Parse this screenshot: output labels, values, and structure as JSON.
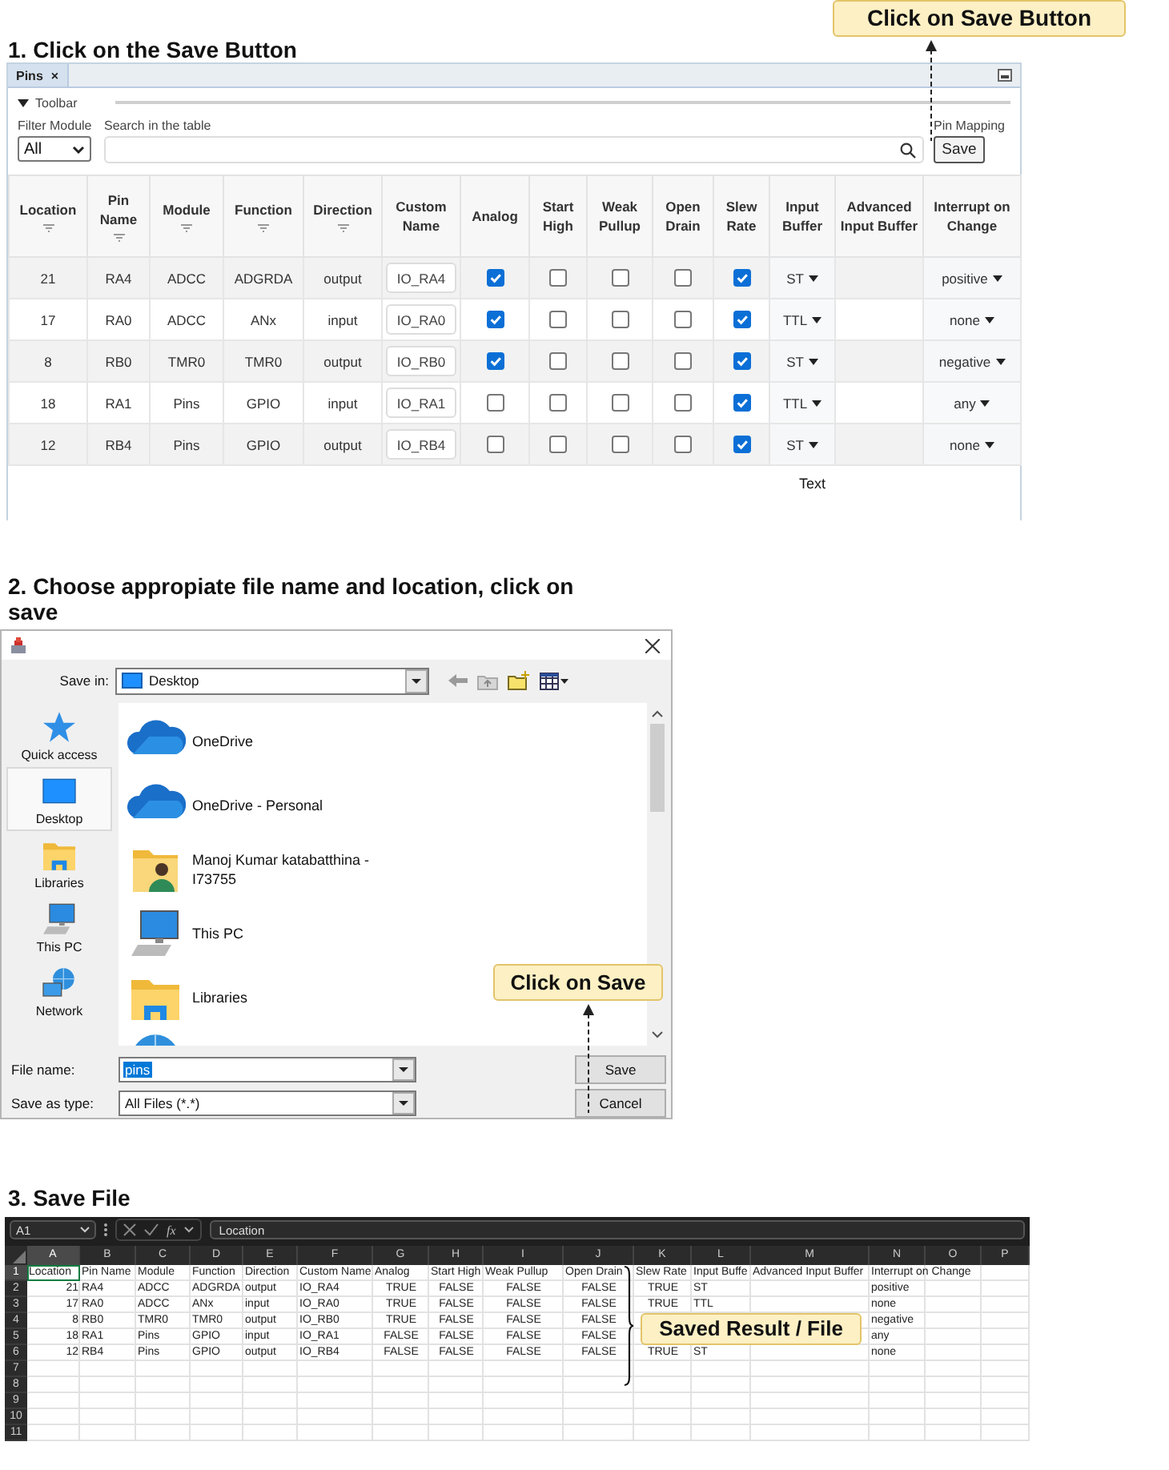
{
  "step_1": {
    "heading": "1. Click on the Save Button",
    "callout": "Click on Save Button"
  },
  "pins_panel": {
    "tab": "Pins",
    "tab_close": "×",
    "toolbar_label": "Toolbar",
    "toolbar_expanded": true,
    "filter_label": "Filter Module",
    "filter_value": "All",
    "search_label": "Search in the table",
    "pin_mapping_label": "Pin Mapping",
    "save_button": "Save",
    "columns": [
      {
        "label": "Location",
        "filter": true
      },
      {
        "label": "Pin Name",
        "filter": true
      },
      {
        "label": "Module",
        "filter": true
      },
      {
        "label": "Function",
        "filter": true
      },
      {
        "label": "Direction",
        "filter": true
      },
      {
        "label": "Custom Name",
        "filter": false
      },
      {
        "label": "Analog",
        "filter": false
      },
      {
        "label": "Start High",
        "filter": false
      },
      {
        "label": "Weak Pullup",
        "filter": false
      },
      {
        "label": "Open Drain",
        "filter": false
      },
      {
        "label": "Slew Rate",
        "filter": false
      },
      {
        "label": "Input Buffer",
        "filter": false
      },
      {
        "label": "Advanced Input Buffer",
        "filter": false
      },
      {
        "label": "Interrupt on Change",
        "filter": false
      }
    ],
    "rows": [
      {
        "location": "21",
        "pin_name": "RA4",
        "module": "ADCC",
        "function": "ADGRDA",
        "direction": "output",
        "custom_name": "IO_RA4",
        "analog": true,
        "start_high": false,
        "weak_pullup": false,
        "open_drain": false,
        "slew_rate": true,
        "input_buffer": "ST",
        "interrupt_on_change": "positive"
      },
      {
        "location": "17",
        "pin_name": "RA0",
        "module": "ADCC",
        "function": "ANx",
        "direction": "input",
        "custom_name": "IO_RA0",
        "analog": true,
        "start_high": false,
        "weak_pullup": false,
        "open_drain": false,
        "slew_rate": true,
        "input_buffer": "TTL",
        "interrupt_on_change": "none"
      },
      {
        "location": "8",
        "pin_name": "RB0",
        "module": "TMR0",
        "function": "TMR0",
        "direction": "output",
        "custom_name": "IO_RB0",
        "analog": true,
        "start_high": false,
        "weak_pullup": false,
        "open_drain": false,
        "slew_rate": true,
        "input_buffer": "ST",
        "interrupt_on_change": "negative"
      },
      {
        "location": "18",
        "pin_name": "RA1",
        "module": "Pins",
        "function": "GPIO",
        "direction": "input",
        "custom_name": "IO_RA1",
        "analog": false,
        "start_high": false,
        "weak_pullup": false,
        "open_drain": false,
        "slew_rate": true,
        "input_buffer": "TTL",
        "interrupt_on_change": "any"
      },
      {
        "location": "12",
        "pin_name": "RB4",
        "module": "Pins",
        "function": "GPIO",
        "direction": "output",
        "custom_name": "IO_RB4",
        "analog": false,
        "start_high": false,
        "weak_pullup": false,
        "open_drain": false,
        "slew_rate": true,
        "input_buffer": "ST",
        "interrupt_on_change": "none"
      }
    ],
    "caption": "Text"
  },
  "step_2": {
    "heading": "2. Choose appropiate file name and location, click on save",
    "callout": "Click on Save"
  },
  "save_dialog": {
    "save_in_label": "Save in:",
    "save_in_value": "Desktop",
    "places": [
      {
        "label": "Quick access",
        "kind": "star",
        "selected": false
      },
      {
        "label": "Desktop",
        "kind": "desktop",
        "selected": true
      },
      {
        "label": "Libraries",
        "kind": "library",
        "selected": false
      },
      {
        "label": "This PC",
        "kind": "pc",
        "selected": false
      },
      {
        "label": "Network",
        "kind": "network",
        "selected": false
      }
    ],
    "items": [
      {
        "name": "OneDrive",
        "kind": "cloud"
      },
      {
        "name": "OneDrive - Personal",
        "kind": "cloud"
      },
      {
        "name": "Manoj Kumar katabatthina - I73755",
        "kind": "user-folder"
      },
      {
        "name": "This PC",
        "kind": "pc"
      },
      {
        "name": "Libraries",
        "kind": "library"
      },
      {
        "kind": "globe"
      }
    ],
    "file_name_label": "File name:",
    "file_name": "pins",
    "file_name_selected": true,
    "type_label": "Save as type:",
    "type_value": "All Files (*.*)",
    "buttons": [
      "Save",
      "Cancel"
    ]
  },
  "step_3": {
    "heading": "3. Save File",
    "callout": "Saved Result / File"
  },
  "spreadsheet": {
    "name_box": "A1",
    "function_symbol": "fx",
    "formula": "Location",
    "columns": [
      {
        "letter": "A",
        "selected": true
      },
      {
        "letter": "B",
        "selected": false
      },
      {
        "letter": "C",
        "selected": false
      },
      {
        "letter": "D",
        "selected": false
      },
      {
        "letter": "E",
        "selected": false
      },
      {
        "letter": "F",
        "selected": false
      },
      {
        "letter": "G",
        "selected": false
      },
      {
        "letter": "H",
        "selected": false
      },
      {
        "letter": "I",
        "selected": false
      },
      {
        "letter": "J",
        "selected": false
      },
      {
        "letter": "K",
        "selected": false
      },
      {
        "letter": "L",
        "selected": false
      },
      {
        "letter": "M",
        "selected": false
      },
      {
        "letter": "N",
        "selected": false
      },
      {
        "letter": "O",
        "selected": false
      },
      {
        "letter": "P",
        "selected": false
      }
    ],
    "rows": [
      {
        "number": "1",
        "selected": true,
        "cells": [
          "Location",
          "Pin Name",
          "Module",
          "Function",
          "Direction",
          "Custom Name",
          "Analog",
          "Start High",
          "Weak Pullup",
          "Open Drain",
          "Slew Rate",
          "Input Buffe",
          "Advanced Input Buffer",
          "Interrupt on Change",
          null,
          null
        ]
      },
      {
        "number": "2",
        "selected": false,
        "cells": [
          "21",
          "RA4",
          "ADCC",
          "ADGRDA",
          "output",
          "IO_RA4",
          "TRUE",
          "FALSE",
          "FALSE",
          "FALSE",
          "TRUE",
          "ST",
          null,
          "positive",
          null,
          null
        ]
      },
      {
        "number": "3",
        "selected": false,
        "cells": [
          "17",
          "RA0",
          "ADCC",
          "ANx",
          "input",
          "IO_RA0",
          "TRUE",
          "FALSE",
          "FALSE",
          "FALSE",
          "TRUE",
          "TTL",
          null,
          "none",
          null,
          null
        ]
      },
      {
        "number": "4",
        "selected": false,
        "cells": [
          "8",
          "RB0",
          "TMR0",
          "TMR0",
          "output",
          "IO_RB0",
          "TRUE",
          "FALSE",
          "FALSE",
          "FALSE",
          null,
          null,
          null,
          "negative",
          null,
          null
        ]
      },
      {
        "number": "5",
        "selected": false,
        "cells": [
          "18",
          "RA1",
          "Pins",
          "GPIO",
          "input",
          "IO_RA1",
          "FALSE",
          "FALSE",
          "FALSE",
          "FALSE",
          null,
          null,
          null,
          "any",
          null,
          null
        ]
      },
      {
        "number": "6",
        "selected": false,
        "cells": [
          "12",
          "RB4",
          "Pins",
          "GPIO",
          "output",
          "IO_RB4",
          "FALSE",
          "FALSE",
          "FALSE",
          "FALSE",
          "TRUE",
          "ST",
          null,
          "none",
          null,
          null
        ]
      },
      {
        "number": "7",
        "selected": false
      },
      {
        "number": "8",
        "selected": false
      },
      {
        "number": "9",
        "selected": false
      },
      {
        "number": "10",
        "selected": false
      },
      {
        "number": "11",
        "selected": false
      }
    ]
  }
}
